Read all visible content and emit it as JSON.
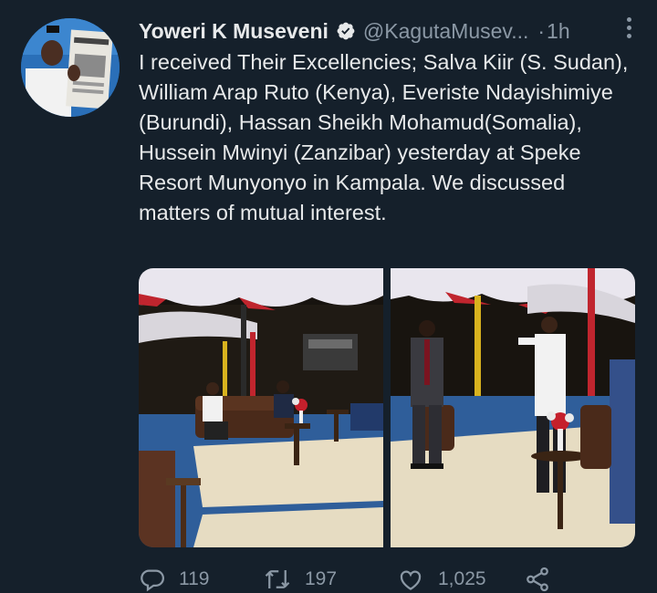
{
  "tweet": {
    "author_name": "Yoweri K Museveni",
    "handle": "@KagutaMusev...",
    "separator": "·",
    "time": "1h",
    "text": "I received Their Excellencies; Salva Kiir (S. Sudan), William Arap Ruto (Kenya), Everiste Ndayishimiye (Burundi), Hassan Sheikh Mohamud(Somalia), Hussein Mwinyi (Zanzibar) yesterday at Speke Resort Munyonyo in Kampala. We discussed matters of mutual interest.",
    "verified": true
  },
  "actions": {
    "reply_count": "119",
    "retweet_count": "197",
    "like_count": "1,025"
  },
  "icons": {
    "verified": "verified-badge-icon",
    "more": "more-options-icon",
    "reply": "reply-icon",
    "retweet": "retweet-icon",
    "like": "heart-icon",
    "share": "share-icon"
  },
  "colors": {
    "background": "#15202b",
    "text": "#e7e9ea",
    "secondary": "#8b98a5"
  }
}
